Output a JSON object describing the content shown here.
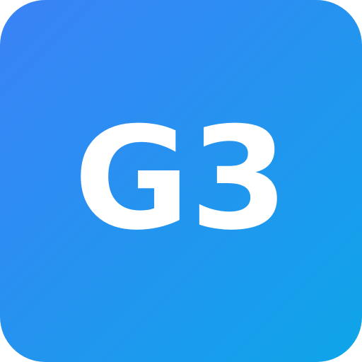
{
  "icon": {
    "label": "G3",
    "gradient_start": "#3b82f6",
    "gradient_end": "#0ea5e9",
    "text_color": "#ffffff"
  }
}
